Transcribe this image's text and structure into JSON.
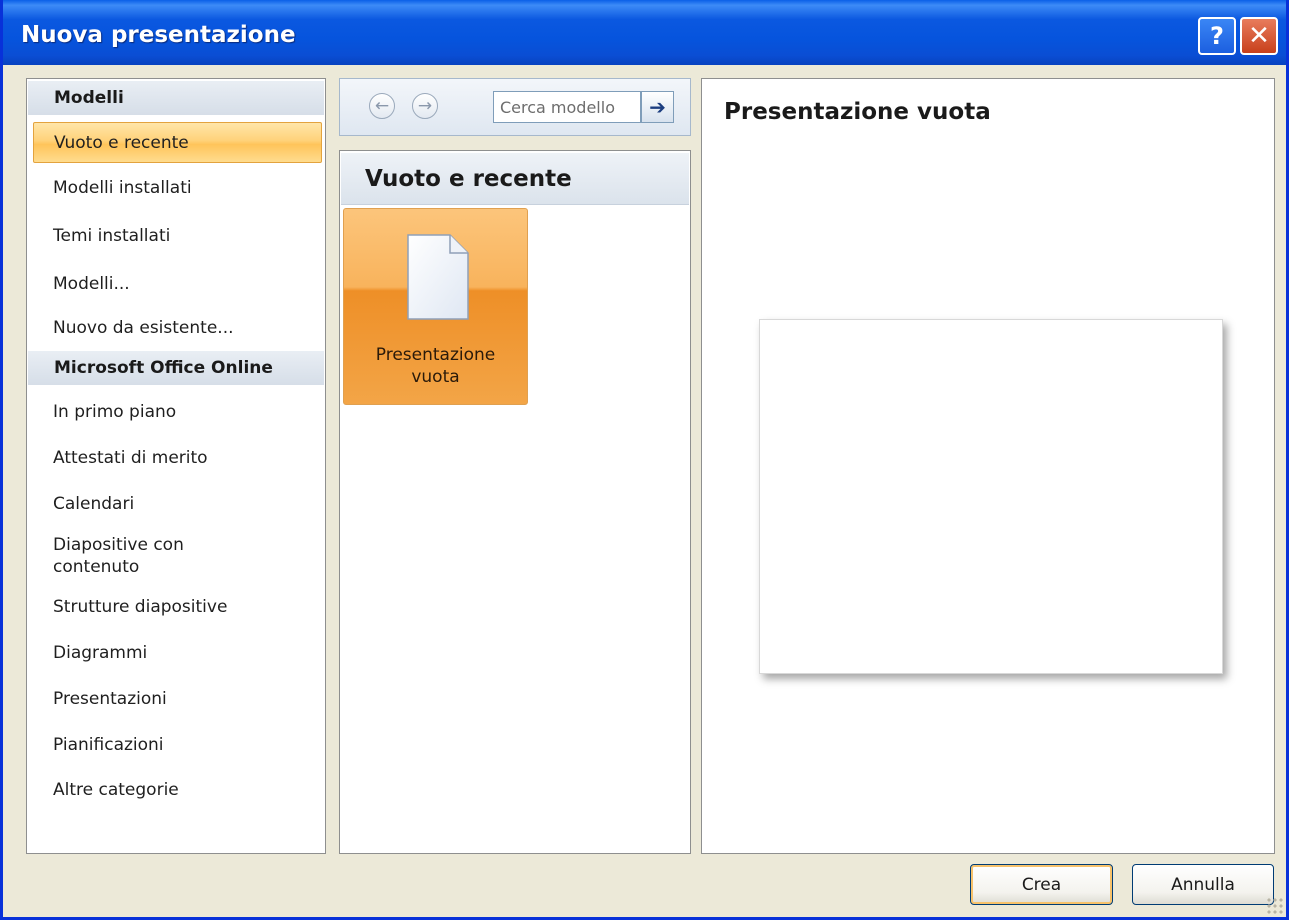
{
  "window": {
    "title": "Nuova presentazione",
    "help_label": "?",
    "close_label": "✕"
  },
  "nav": {
    "back_glyph": "←",
    "forward_glyph": "→",
    "search_value": "Cerca modello",
    "go_glyph": "➔"
  },
  "sidebar": {
    "header_templates": "Modelli",
    "templates_items": [
      {
        "label": "Vuoto e recente",
        "selected": true
      },
      {
        "label": "Modelli installati"
      },
      {
        "label": "Temi installati"
      },
      {
        "label": "Modelli..."
      },
      {
        "label": "Nuovo da esistente..."
      }
    ],
    "header_online": "Microsoft Office Online",
    "online_items": [
      {
        "label": "In primo piano"
      },
      {
        "label": "Attestati di merito"
      },
      {
        "label": "Calendari"
      },
      {
        "label": "Diapositive con\ncontenuto"
      },
      {
        "label": "Strutture diapositive"
      },
      {
        "label": "Diagrammi"
      },
      {
        "label": "Presentazioni"
      },
      {
        "label": "Pianificazioni"
      },
      {
        "label": "Altre categorie"
      }
    ]
  },
  "middle": {
    "header": "Vuoto e recente",
    "tile_label": "Presentazione\nvuota"
  },
  "preview": {
    "title": "Presentazione vuota"
  },
  "buttons": {
    "create": "Crea",
    "cancel": "Annulla"
  },
  "colors": {
    "titlebar": "#0654dd",
    "selection": "#ffd27a",
    "tile": "#f3a547"
  }
}
